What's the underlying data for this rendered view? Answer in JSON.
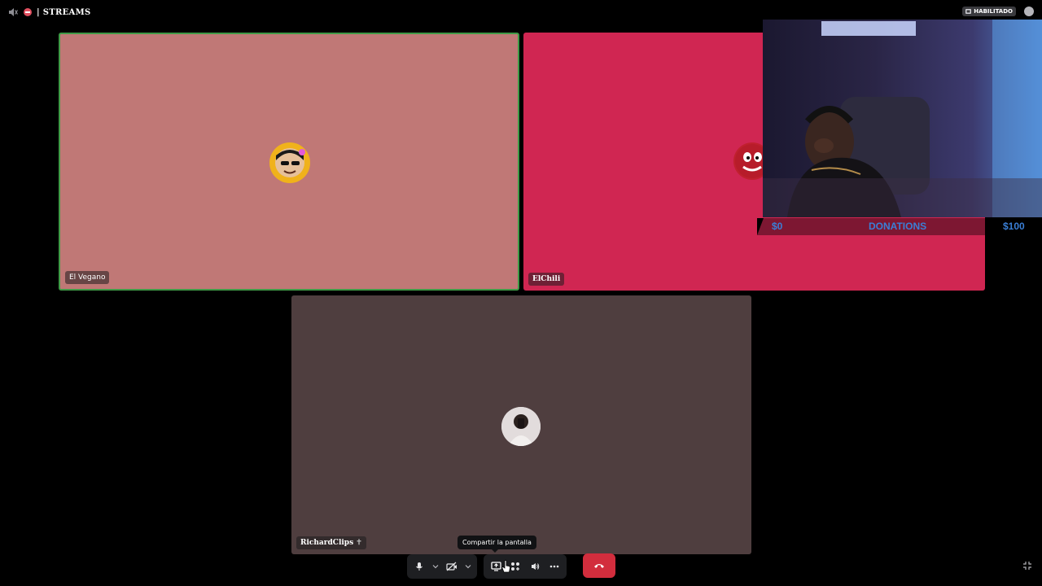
{
  "topbar": {
    "channel_name": "| STREAMS",
    "status_badge": "HABILITADO"
  },
  "tiles": {
    "vegano": {
      "name": "El Vegano"
    },
    "chili": {
      "name": "ElChili"
    },
    "richard": {
      "name": "RichardClips",
      "name_suffix": "✝"
    }
  },
  "donations": {
    "start": "$0",
    "label": "DONATIONS",
    "goal": "$100"
  },
  "controls": {
    "tooltip": "Compartir la pantalla"
  },
  "colors": {
    "vegano_tile": "#c07876",
    "speaking_border": "#3f9a46",
    "chili_tile": "#d02652",
    "richard_tile": "#4f3e3f",
    "end_call": "#d22d3d",
    "donation_text": "#3a7fd6"
  },
  "icons": [
    "speaker-muted-icon",
    "dnd-icon",
    "badge-icon",
    "chat-icon",
    "mic-icon",
    "chevron-down-icon",
    "camera-off-icon",
    "screen-share-icon",
    "activities-icon",
    "soundboard-icon",
    "more-icon",
    "hang-up-icon",
    "collapse-icon"
  ]
}
